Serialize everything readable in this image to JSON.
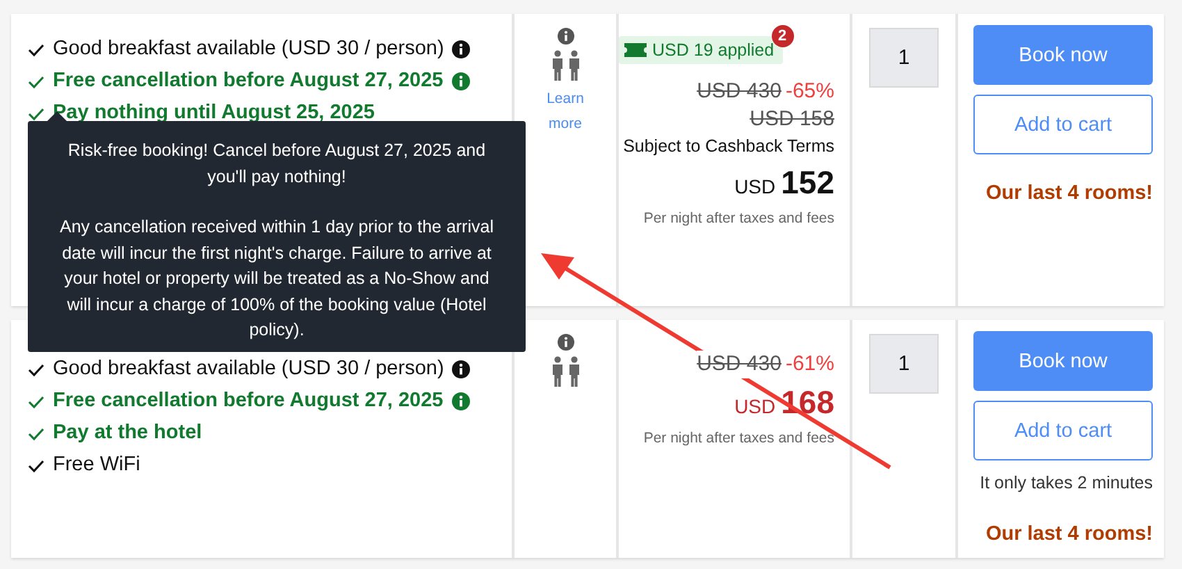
{
  "offers": [
    {
      "features": [
        {
          "text": "Good breakfast available (USD 30 / person)",
          "highlight": false,
          "info": true
        },
        {
          "text": "Free cancellation before August 27, 2025",
          "highlight": true,
          "info": true
        },
        {
          "text": "Pay nothing until August 25, 2025",
          "highlight": true,
          "info": false
        }
      ],
      "occupancy": {
        "info": true,
        "link": [
          "Learn",
          "more"
        ]
      },
      "coupon": {
        "label": "USD 19 applied",
        "count": "2"
      },
      "original_price": "USD 430",
      "discount": "-65%",
      "crossed_price": "USD 158",
      "terms": "Subject to Cashback Terms",
      "currency": "USD",
      "price": "152",
      "price_highlight": false,
      "price_note": "Per night after taxes and fees",
      "quantity": "1",
      "book_label": "Book now",
      "cart_label": "Add to cart",
      "urgency": "Our last 4 rooms!"
    },
    {
      "features": [
        {
          "text": "Good breakfast available (USD 30 / person)",
          "highlight": false,
          "info": true
        },
        {
          "text": "Free cancellation before August 27, 2025",
          "highlight": true,
          "info": true
        },
        {
          "text": "Pay at the hotel",
          "highlight": true,
          "info": false
        },
        {
          "text": "Free WiFi",
          "highlight": false,
          "info": false
        }
      ],
      "occupancy": {
        "info": true
      },
      "original_price": "USD 430",
      "discount": "-61%",
      "currency": "USD",
      "price": "168",
      "price_highlight": true,
      "price_note": "Per night after taxes and fees",
      "quantity": "1",
      "book_label": "Book now",
      "cart_label": "Add to cart",
      "cart_note": "It only takes 2 minutes",
      "urgency": "Our last 4 rooms!"
    }
  ],
  "tooltip": {
    "paragraphs": [
      "Risk-free booking! Cancel before August 27, 2025 and you'll pay nothing!",
      "Any cancellation received within 1 day prior to the arrival date will incur the first night's charge. Failure to arrive at your hotel or property will be treated as a No-Show and will incur a charge of 100% of the booking value (Hotel policy)."
    ]
  }
}
